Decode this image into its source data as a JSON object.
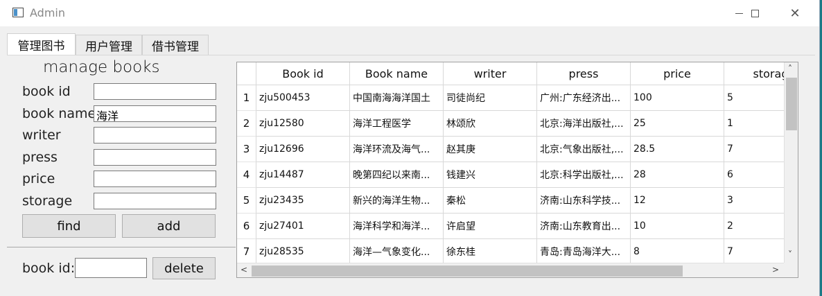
{
  "window": {
    "title": "Admin",
    "min_icon": "minimize-icon",
    "max_icon": "maximize-icon",
    "close_icon": "close-icon",
    "close_glyph": "✕"
  },
  "tabs": [
    {
      "label": "管理图书",
      "active": true
    },
    {
      "label": "用户管理",
      "active": false
    },
    {
      "label": "借书管理",
      "active": false
    }
  ],
  "form": {
    "title": "manage books",
    "fields": [
      {
        "label": "book id",
        "value": ""
      },
      {
        "label": "book name",
        "value": "海洋"
      },
      {
        "label": "writer",
        "value": ""
      },
      {
        "label": "press",
        "value": ""
      },
      {
        "label": "price",
        "value": ""
      },
      {
        "label": "storage",
        "value": ""
      }
    ],
    "find_label": "find",
    "add_label": "add",
    "delete_field_label": "book id:",
    "delete_field_value": "",
    "delete_label": "delete"
  },
  "table": {
    "columns": [
      "Book id",
      "Book name",
      "writer",
      "press",
      "price",
      "storag"
    ],
    "rows": [
      {
        "num": "1",
        "cells": [
          "zju500453",
          "中国南海海洋国土",
          "司徒尚纪",
          "广州:广东经济出...",
          "100",
          "5"
        ]
      },
      {
        "num": "2",
        "cells": [
          "zju12580",
          "海洋工程医学",
          "林颂欣",
          "北京:海洋出版社,...",
          "25",
          "1"
        ]
      },
      {
        "num": "3",
        "cells": [
          "zju12696",
          "海洋环流及海气...",
          "赵其庚",
          "北京:气象出版社,...",
          "28.5",
          "7"
        ]
      },
      {
        "num": "4",
        "cells": [
          "zju14487",
          "晚第四纪以来南...",
          "钱建兴",
          "北京:科学出版社,...",
          "28",
          "6"
        ]
      },
      {
        "num": "5",
        "cells": [
          "zju23435",
          "新兴的海洋生物...",
          "秦松",
          "济南:山东科学技...",
          "12",
          "3"
        ]
      },
      {
        "num": "6",
        "cells": [
          "zju27401",
          "海洋科学和海洋...",
          "许启望",
          "济南:山东教育出...",
          "10",
          "2"
        ]
      },
      {
        "num": "7",
        "cells": [
          "zju28535",
          "海洋—气象变化...",
          "徐东桂",
          "青岛:青岛海洋大...",
          "8",
          "7"
        ]
      }
    ],
    "scroll_up": "˄",
    "scroll_down": "˅",
    "scroll_left": "<",
    "scroll_right": ">"
  }
}
